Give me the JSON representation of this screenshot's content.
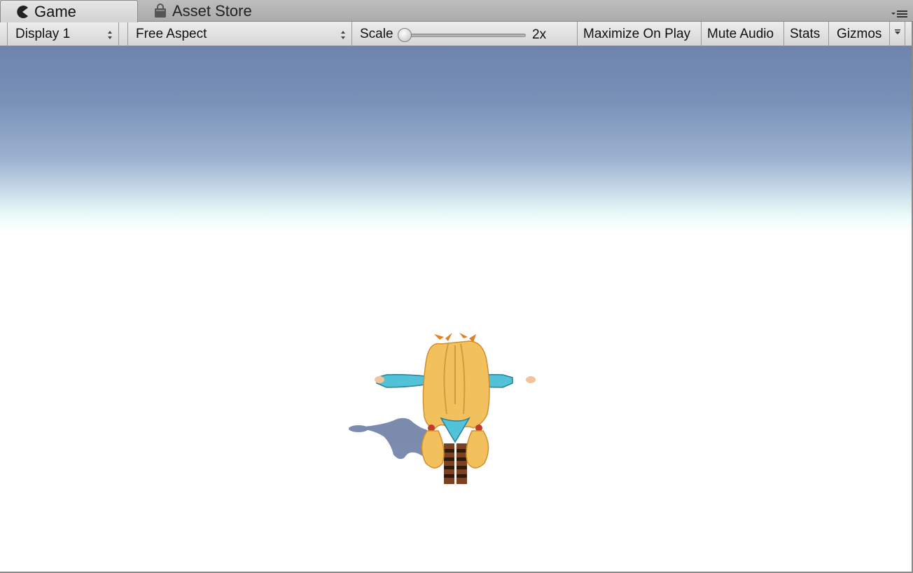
{
  "tabs": {
    "game_label": "Game",
    "asset_store_label": "Asset Store"
  },
  "toolbar": {
    "display_value": "Display 1",
    "aspect_value": "Free Aspect",
    "scale_label": "Scale",
    "scale_value": "2x",
    "scale_slider_fraction": 0.0,
    "maximize_label": "Maximize On Play",
    "mute_label": "Mute Audio",
    "stats_label": "Stats",
    "gizmos_label": "Gizmos"
  },
  "colors": {
    "sky_top": "#6e84ad",
    "horizon": "#eefbfb",
    "ground": "#ffffff",
    "toolbar_bg": "#e2e2e2",
    "tab_active": "#dcdcdc"
  },
  "icons": {
    "game_tab": "pacman-icon",
    "asset_store_tab": "shopping-bag-icon",
    "panel_menu": "panel-menu-icon"
  }
}
